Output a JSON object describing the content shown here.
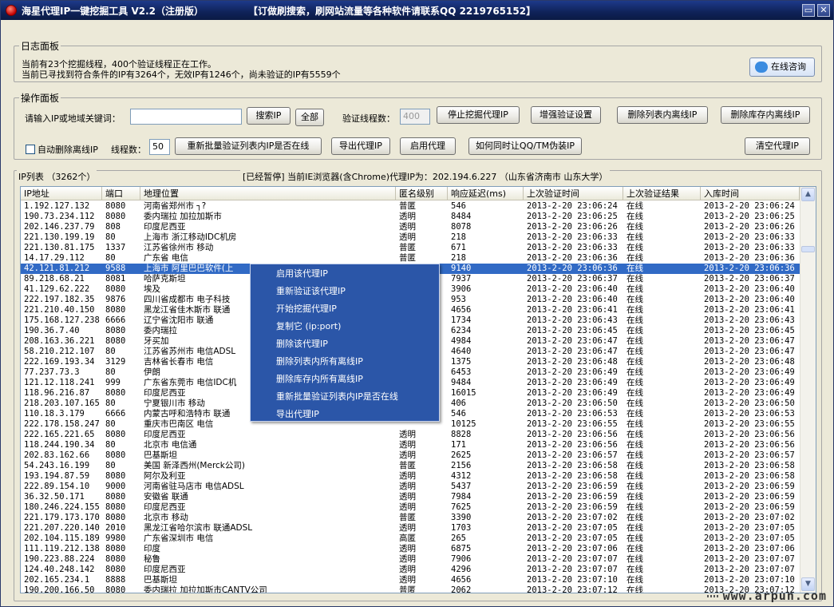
{
  "window": {
    "title": "海星代理IP一键挖掘工具 V2.2（注册版）",
    "ad_text": "【订做刷搜索，刷网站流量等各种软件请联系QQ 2219765152】",
    "min_glyph": "▭",
    "close_glyph": "✕"
  },
  "log_panel": {
    "legend": "日志面板",
    "line1": "当前有23个挖掘线程，400个验证线程正在工作。",
    "line2": "当前已寻找到符合条件的IP有3264个，无效IP有1246个，尚未验证的IP有5559个",
    "consult_button": "在线咨询"
  },
  "ops_panel": {
    "legend": "操作面板",
    "search_label": "请输入IP或地域关键词：",
    "search_value": "",
    "search_button": "搜索IP",
    "all_button": "全部",
    "verify_threads_label": "验证线程数：",
    "verify_threads_value": "400",
    "stop_mining_button": "停止挖掘代理IP",
    "enhanced_verify_button": "增强验证设置",
    "delete_offline_list_button": "删除列表内离线IP",
    "delete_offline_store_button": "删除库存内离线IP",
    "auto_delete_label": "自动删除离线IP",
    "thread_count_label": "线程数：",
    "thread_count_value": "50",
    "reverify_button": "重新批量验证列表内IP是否在线",
    "export_button": "导出代理IP",
    "enable_proxy_button": "启用代理",
    "qq_tm_button": "如何同时让QQ/TM伪装IP",
    "clear_proxy_button": "清空代理IP"
  },
  "ip_list": {
    "legend": "IP列表 （3262个）",
    "status": "[已经暂停] 当前IE浏览器(含Chrome)代理IP为：202.194.6.227 （山东省济南市 山东大学）",
    "columns": [
      "IP地址",
      "端口",
      "地理位置",
      "匿名级别",
      "响应延迟(ms)",
      "上次验证时间",
      "上次验证结果",
      "入库时间"
    ],
    "selected_index": 6,
    "rows": [
      [
        "1.192.127.132",
        "8080",
        "河南省郑州市 ┐?",
        "普匿",
        "546",
        "2013-2-20 23:06:24",
        "在线",
        "2013-2-20 23:06:24"
      ],
      [
        "190.73.234.112",
        "8080",
        "委内瑞拉 加拉加斯市",
        "透明",
        "8484",
        "2013-2-20 23:06:25",
        "在线",
        "2013-2-20 23:06:25"
      ],
      [
        "202.146.237.79",
        "808",
        "印度尼西亚",
        "透明",
        "8078",
        "2013-2-20 23:06:26",
        "在线",
        "2013-2-20 23:06:26"
      ],
      [
        "221.130.199.19",
        "80",
        "上海市 浙江移动IDC机房",
        "透明",
        "218",
        "2013-2-20 23:06:33",
        "在线",
        "2013-2-20 23:06:33"
      ],
      [
        "221.130.81.175",
        "1337",
        "江苏省徐州市 移动",
        "普匿",
        "671",
        "2013-2-20 23:06:33",
        "在线",
        "2013-2-20 23:06:33"
      ],
      [
        "14.17.29.112",
        "80",
        "广东省 电信",
        "普匿",
        "218",
        "2013-2-20 23:06:36",
        "在线",
        "2013-2-20 23:06:36"
      ],
      [
        "42.121.81.212",
        "9588",
        "上海市 阿里巴巴软件(上",
        "",
        "9140",
        "2013-2-20 23:06:36",
        "在线",
        "2013-2-20 23:06:36"
      ],
      [
        "89.218.68.21",
        "8081",
        "哈萨克斯坦",
        "",
        "7937",
        "2013-2-20 23:06:37",
        "在线",
        "2013-2-20 23:06:37"
      ],
      [
        "41.129.62.222",
        "8080",
        "埃及",
        "",
        "3906",
        "2013-2-20 23:06:40",
        "在线",
        "2013-2-20 23:06:40"
      ],
      [
        "222.197.182.35",
        "9876",
        "四川省成都市 电子科技",
        "",
        "953",
        "2013-2-20 23:06:40",
        "在线",
        "2013-2-20 23:06:40"
      ],
      [
        "221.210.40.150",
        "8080",
        "黑龙江省佳木斯市 联通",
        "",
        "4656",
        "2013-2-20 23:06:41",
        "在线",
        "2013-2-20 23:06:41"
      ],
      [
        "175.168.127.238",
        "6666",
        "辽宁省沈阳市 联通",
        "",
        "1734",
        "2013-2-20 23:06:43",
        "在线",
        "2013-2-20 23:06:43"
      ],
      [
        "190.36.7.40",
        "8080",
        "委内瑞拉",
        "",
        "6234",
        "2013-2-20 23:06:45",
        "在线",
        "2013-2-20 23:06:45"
      ],
      [
        "208.163.36.221",
        "8080",
        "牙买加",
        "",
        "4984",
        "2013-2-20 23:06:47",
        "在线",
        "2013-2-20 23:06:47"
      ],
      [
        "58.210.212.107",
        "80",
        "江苏省苏州市 电信ADSL",
        "",
        "4640",
        "2013-2-20 23:06:47",
        "在线",
        "2013-2-20 23:06:47"
      ],
      [
        "222.169.193.34",
        "3129",
        "吉林省长春市 电信",
        "",
        "1375",
        "2013-2-20 23:06:48",
        "在线",
        "2013-2-20 23:06:48"
      ],
      [
        "77.237.73.3",
        "80",
        "伊朗",
        "",
        "6453",
        "2013-2-20 23:06:49",
        "在线",
        "2013-2-20 23:06:49"
      ],
      [
        "121.12.118.241",
        "999",
        "广东省东莞市 电信IDC机",
        "",
        "9484",
        "2013-2-20 23:06:49",
        "在线",
        "2013-2-20 23:06:49"
      ],
      [
        "118.96.216.87",
        "8080",
        "印度尼西亚",
        "",
        "16015",
        "2013-2-20 23:06:49",
        "在线",
        "2013-2-20 23:06:49"
      ],
      [
        "218.203.107.165",
        "80",
        "宁夏银川市 移动",
        "",
        "406",
        "2013-2-20 23:06:50",
        "在线",
        "2013-2-20 23:06:50"
      ],
      [
        "110.18.3.179",
        "6666",
        "内蒙古呼和浩特市 联通",
        "",
        "546",
        "2013-2-20 23:06:53",
        "在线",
        "2013-2-20 23:06:53"
      ],
      [
        "222.178.158.247",
        "80",
        "重庆市巴南区 电信",
        "",
        "10125",
        "2013-2-20 23:06:55",
        "在线",
        "2013-2-20 23:06:55"
      ],
      [
        "222.165.221.65",
        "8080",
        "印度尼西亚",
        "透明",
        "8828",
        "2013-2-20 23:06:56",
        "在线",
        "2013-2-20 23:06:56"
      ],
      [
        "118.244.190.34",
        "80",
        "北京市 电信通",
        "透明",
        "171",
        "2013-2-20 23:06:56",
        "在线",
        "2013-2-20 23:06:56"
      ],
      [
        "202.83.162.66",
        "8080",
        "巴基斯坦",
        "透明",
        "2625",
        "2013-2-20 23:06:57",
        "在线",
        "2013-2-20 23:06:57"
      ],
      [
        "54.243.16.199",
        "80",
        "美国 新泽西州(Merck公司)",
        "普匿",
        "2156",
        "2013-2-20 23:06:58",
        "在线",
        "2013-2-20 23:06:58"
      ],
      [
        "193.194.87.59",
        "8080",
        "阿尔及利亚",
        "透明",
        "4312",
        "2013-2-20 23:06:58",
        "在线",
        "2013-2-20 23:06:58"
      ],
      [
        "222.89.154.10",
        "9000",
        "河南省驻马店市 电信ADSL",
        "透明",
        "5437",
        "2013-2-20 23:06:59",
        "在线",
        "2013-2-20 23:06:59"
      ],
      [
        "36.32.50.171",
        "8080",
        "安徽省 联通",
        "透明",
        "7984",
        "2013-2-20 23:06:59",
        "在线",
        "2013-2-20 23:06:59"
      ],
      [
        "180.246.224.155",
        "8080",
        "印度尼西亚",
        "透明",
        "7625",
        "2013-2-20 23:06:59",
        "在线",
        "2013-2-20 23:06:59"
      ],
      [
        "221.179.173.170",
        "8080",
        "北京市 移动",
        "普匿",
        "3390",
        "2013-2-20 23:07:02",
        "在线",
        "2013-2-20 23:07:02"
      ],
      [
        "221.207.220.140",
        "2010",
        "黑龙江省哈尔滨市 联通ADSL",
        "透明",
        "1703",
        "2013-2-20 23:07:05",
        "在线",
        "2013-2-20 23:07:05"
      ],
      [
        "202.104.115.189",
        "9980",
        "广东省深圳市 电信",
        "高匿",
        "265",
        "2013-2-20 23:07:05",
        "在线",
        "2013-2-20 23:07:05"
      ],
      [
        "111.119.212.138",
        "8080",
        "印度",
        "透明",
        "6875",
        "2013-2-20 23:07:06",
        "在线",
        "2013-2-20 23:07:06"
      ],
      [
        "190.223.88.224",
        "8080",
        "秘鲁",
        "透明",
        "7906",
        "2013-2-20 23:07:07",
        "在线",
        "2013-2-20 23:07:07"
      ],
      [
        "124.40.248.142",
        "8080",
        "印度尼西亚",
        "透明",
        "4296",
        "2013-2-20 23:07:07",
        "在线",
        "2013-2-20 23:07:07"
      ],
      [
        "202.165.234.1",
        "8888",
        "巴基斯坦",
        "透明",
        "4656",
        "2013-2-20 23:07:10",
        "在线",
        "2013-2-20 23:07:10"
      ],
      [
        "190.200.166.50",
        "8080",
        "委内瑞拉 加拉加斯市CANTV公司",
        "普匿",
        "2062",
        "2013-2-20 23:07:12",
        "在线",
        "2013-2-20 23:07:12"
      ]
    ]
  },
  "context_menu": {
    "items": [
      "启用该代理IP",
      "重新验证该代理IP",
      "开始挖掘代理IP",
      "复制它 (ip:port)",
      "删除该代理IP",
      "删除列表内所有离线IP",
      "删除库存内所有离线IP",
      "重新批量验证列表内IP是否在线",
      "导出代理IP"
    ]
  },
  "scrollbar": {
    "up_glyph": "▲",
    "down_glyph": "▼"
  },
  "watermark": "www.arpun.com"
}
